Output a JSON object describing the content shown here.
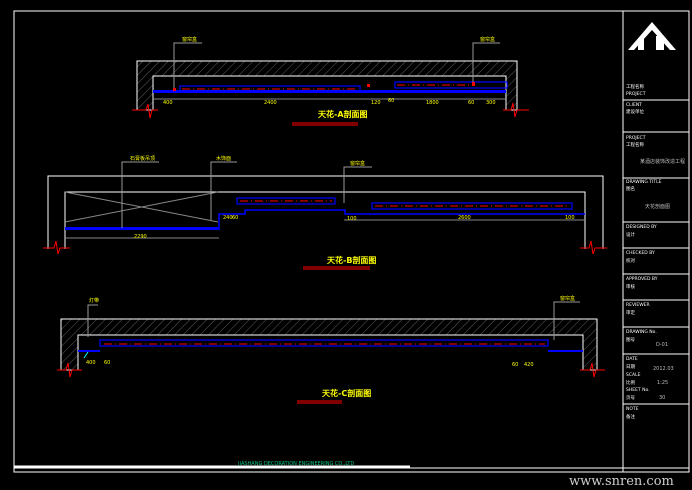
{
  "drawing": {
    "sections": [
      {
        "title": "天花-A剖面图",
        "callouts": [
          "窗帘盒",
          "窗帘盒"
        ],
        "dims": [
          "400",
          "2400",
          "120",
          "60",
          "1800",
          "60",
          "300"
        ]
      },
      {
        "title": "天花-B剖面图",
        "callouts": [
          "石膏板吊顶",
          "木饰面",
          "窗帘盒"
        ],
        "dims": [
          "2290",
          "240",
          "60",
          "100",
          "2600",
          "100"
        ]
      },
      {
        "title": "天花-C剖面图",
        "callouts": [
          "灯带",
          "窗帘盒"
        ],
        "dims": [
          "400",
          "60",
          "60",
          "420"
        ]
      }
    ],
    "company_footer": "JIASHANG DECORATION ENGINEERING CO.,LTD"
  },
  "title_block": {
    "logo_label": "logo",
    "rows": [
      {
        "label": "工程名称",
        "value": "PROJECT"
      },
      {
        "label": "CLIENT",
        "value": "建设单位"
      },
      {
        "label": "PROJECT",
        "value": "工程名称",
        "detail": "某酒店装饰改造工程"
      },
      {
        "label": "DRAWING TITLE",
        "value": "图名",
        "detail": "天花剖面图"
      },
      {
        "label": "DESIGNED BY",
        "value": "设计"
      },
      {
        "label": "CHECKED BY",
        "value": "校对"
      },
      {
        "label": "APPROVED BY",
        "value": "审核"
      },
      {
        "label": "REVIEWER",
        "value": "审定"
      },
      {
        "label": "DRAWING No.",
        "value": "图号",
        "detail": "D-01"
      },
      {
        "label": "DATE",
        "value": "日期",
        "detail": "2012.03"
      },
      {
        "label": "SCALE",
        "value": "比例",
        "detail": "1:25"
      },
      {
        "label": "SHEET No.",
        "value": "页号",
        "detail": "30"
      },
      {
        "label": "NOTE",
        "value": "备注"
      }
    ]
  },
  "watermark": "www.snren.com",
  "colors": {
    "background": "#000000",
    "wall": "#ffffff",
    "ceiling": "#0000ff",
    "centerline": "#ff0000",
    "text": "#ffff00",
    "leader": "#a0a0a0"
  }
}
